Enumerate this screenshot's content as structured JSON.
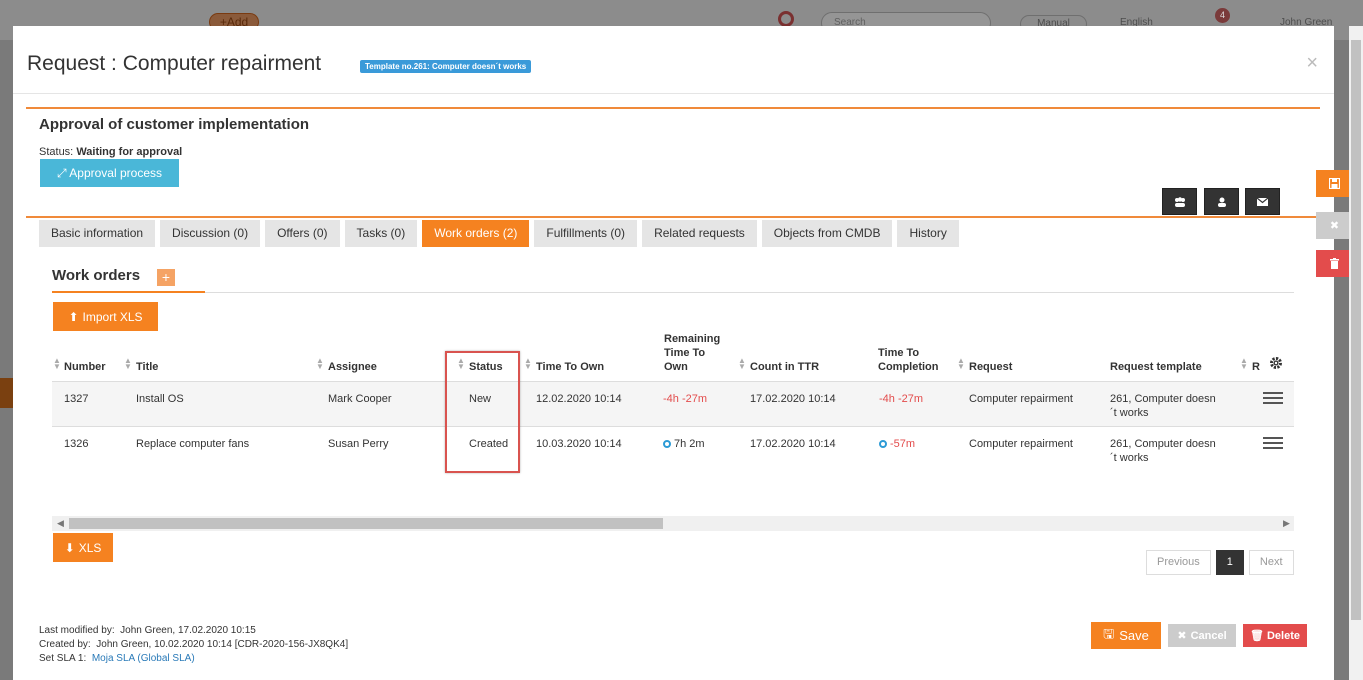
{
  "background": {
    "add_label": "+Add",
    "search_placeholder": "Search",
    "manual_label": "Manual",
    "language": "English",
    "notif_count": "4",
    "user_name": "John Green"
  },
  "modal": {
    "title": "Request : Computer repairment",
    "template_badge": "Template no.261: Computer doesn´t works",
    "close": "×"
  },
  "section": {
    "title": "Approval of customer implementation",
    "status_label": "Status:",
    "status_value": "Waiting for approval",
    "approval_button": "Approval process"
  },
  "tabs": [
    {
      "label": "Basic information"
    },
    {
      "label": "Discussion (0)"
    },
    {
      "label": "Offers (0)"
    },
    {
      "label": "Tasks (0)"
    },
    {
      "label": "Work orders (2)",
      "active": true
    },
    {
      "label": "Fulfillments (0)"
    },
    {
      "label": "Related requests"
    },
    {
      "label": "Objects from CMDB"
    },
    {
      "label": "History"
    }
  ],
  "work_orders": {
    "title": "Work orders",
    "plus": "+",
    "import_button": "Import XLS",
    "xls_button": "XLS",
    "columns": {
      "number": "Number",
      "title": "Title",
      "assignee": "Assignee",
      "status": "Status",
      "time_to_own": "Time To Own",
      "remaining_1": "Remaining",
      "remaining_2": "Time To",
      "remaining_3": "Own",
      "count_ttr": "Count in TTR",
      "ttc_1": "Time To",
      "ttc_2": "Completion",
      "request": "Request",
      "request_template": "Request template",
      "cut": "R"
    },
    "rows": [
      {
        "number": "1327",
        "title": "Install OS",
        "assignee": "Mark Cooper",
        "status": "New",
        "time_to_own": "12.02.2020 10:14",
        "remaining": "-4h -27m",
        "count_ttr": "17.02.2020 10:14",
        "ttc": "-4h -27m",
        "request": "Computer repairment",
        "template_1": "261, Computer doesn",
        "template_2": "´t works"
      },
      {
        "number": "1326",
        "title": "Replace computer fans",
        "assignee": "Susan Perry",
        "status": "Created",
        "time_to_own": "10.03.2020 10:14",
        "remaining": "7h 2m",
        "count_ttr": "17.02.2020 10:14",
        "ttc": "-57m",
        "request": "Computer repairment",
        "template_1": "261, Computer doesn",
        "template_2": "´t works"
      }
    ]
  },
  "pager": {
    "previous": "Previous",
    "current": "1",
    "next": "Next"
  },
  "footer": {
    "modified_label": "Last modified by:",
    "modified_value": "John Green,  17.02.2020 10:15",
    "created_label": "Created by:",
    "created_value": "John Green,  10.02.2020 10:14 [CDR-2020-156-JX8QK4]",
    "sla_label": "Set SLA 1:",
    "sla_value": "Moja SLA (Global SLA)"
  },
  "actions": {
    "save": "Save",
    "cancel": "Cancel",
    "delete": "Delete"
  },
  "colors": {
    "accent": "#f58220",
    "info": "#4ab7d8",
    "danger": "#e34c4c"
  }
}
